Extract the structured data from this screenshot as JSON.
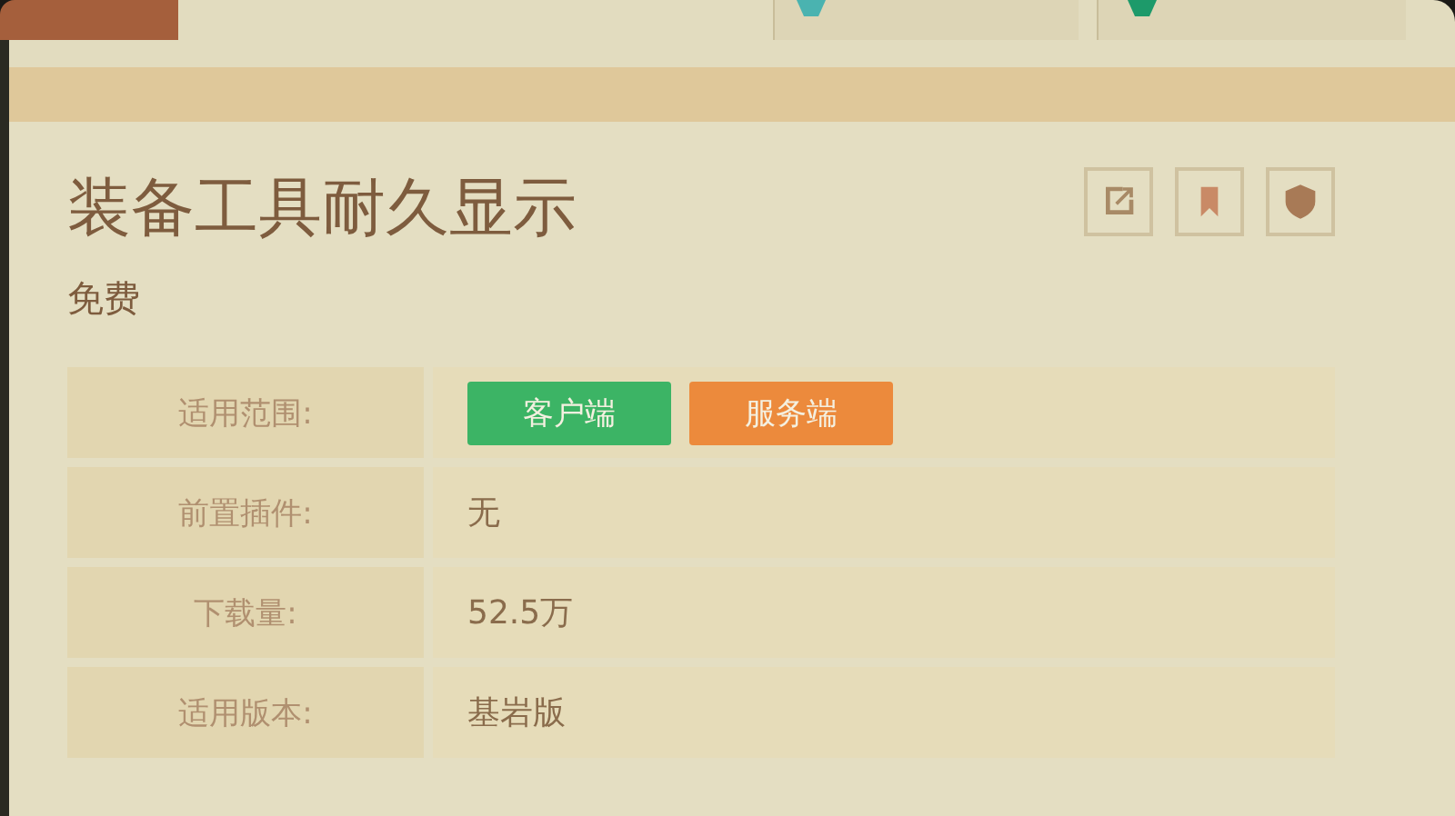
{
  "top_tabs": [
    {
      "selected": true
    },
    {
      "selected": false
    },
    {
      "selected": false
    }
  ],
  "plugin": {
    "title": "装备工具耐久显示",
    "price": "免费"
  },
  "actions": [
    {
      "kind": "share"
    },
    {
      "kind": "bookmark"
    },
    {
      "kind": "shield"
    }
  ],
  "info": [
    {
      "label": "适用范围:",
      "kind": "tags",
      "tags": [
        {
          "text": "客户端",
          "color": "#3cb465"
        },
        {
          "text": "服务端",
          "color": "#ec8a3c"
        }
      ]
    },
    {
      "label": "前置插件:",
      "kind": "text",
      "value": "无"
    },
    {
      "label": "下载量:",
      "kind": "text",
      "value": "52.5万"
    },
    {
      "label": "适用版本:",
      "kind": "text",
      "value": "基岩版"
    }
  ]
}
